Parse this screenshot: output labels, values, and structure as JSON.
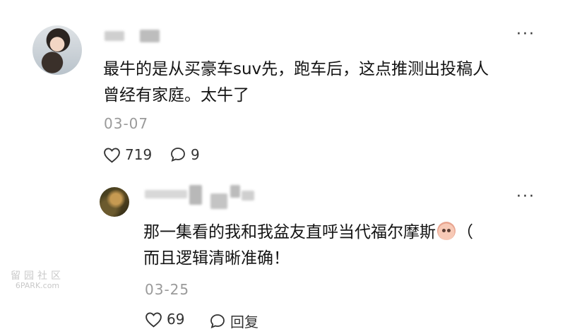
{
  "comment1": {
    "text_line1": "最牛的是从买豪车suv先，跑车后，这点推测出投稿人",
    "text_line2": "曾经有家庭。太牛了",
    "date": "03-07",
    "likes": "719",
    "replies": "9",
    "menu": "···"
  },
  "comment2": {
    "text_line1_a": "那一集看的我和我盆友直呼当代福尔摩斯",
    "text_line1_b": "（",
    "text_line2": "而且逻辑清晰准确！",
    "date": "03-25",
    "likes": "69",
    "reply_label": "回复",
    "menu": "···"
  },
  "watermark": {
    "glyphs": "留园社区",
    "site": "6PARK.com"
  },
  "icons": {
    "heart": "heart-icon",
    "comment": "comment-bubble-icon",
    "more": "more-icon"
  }
}
